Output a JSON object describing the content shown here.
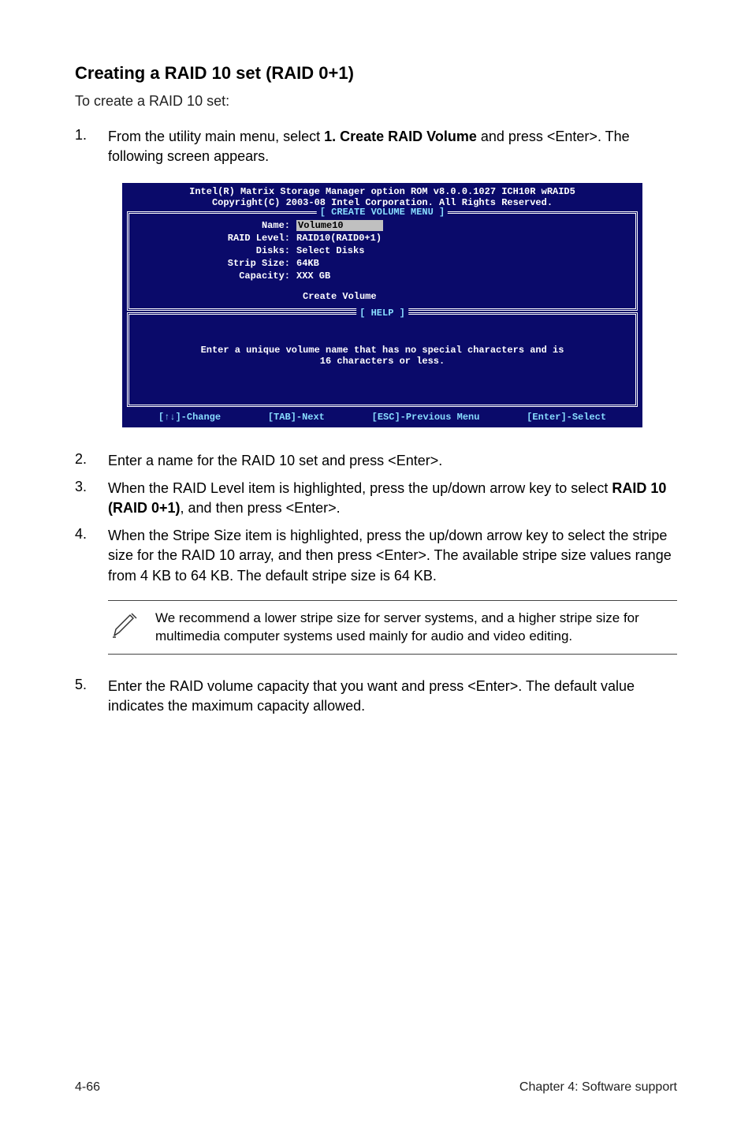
{
  "heading": "Creating a RAID 10 set (RAID 0+1)",
  "intro": "To create a RAID 10 set:",
  "steps": {
    "s1": {
      "num": "1.",
      "prefix": "From the utility main menu, select ",
      "bold": "1. Create RAID Volume",
      "suffix": " and press <Enter>. The following screen appears."
    },
    "s2": {
      "num": "2.",
      "text": "Enter a name for the RAID 10 set and press <Enter>."
    },
    "s3": {
      "num": "3.",
      "prefix": "When the RAID Level item is highlighted, press the up/down arrow key to select ",
      "bold": "RAID 10 (RAID 0+1)",
      "suffix": ", and then press <Enter>."
    },
    "s4": {
      "num": "4.",
      "text": "When the Stripe Size item is highlighted, press the up/down arrow key to select the stripe size for the RAID 10 array, and then press <Enter>. The available stripe size values range from 4 KB to 64 KB. The default stripe size is 64 KB."
    },
    "s5": {
      "num": "5.",
      "text": "Enter the RAID volume capacity that you want and press <Enter>. The default value indicates the maximum capacity allowed."
    }
  },
  "bios": {
    "title": "Intel(R) Matrix Storage Manager option ROM v8.0.0.1027 ICH10R wRAID5",
    "copyright": "Copyright(C) 2003-08 Intel Corporation. All Rights Reserved.",
    "create_legend": "[ CREATE VOLUME MENU ]",
    "help_legend": "[ HELP ]",
    "fields": {
      "name_label": "Name:",
      "name_value": "Volume10",
      "raid_label": "RAID Level:",
      "raid_value": "RAID10(RAID0+1)",
      "disks_label": "Disks:",
      "disks_value": "Select Disks",
      "strip_label": "Strip Size:",
      "strip_value": "64KB",
      "capacity_label": "Capacity:",
      "capacity_value": "XXX   GB"
    },
    "create_volume": "Create Volume",
    "help_text1": "Enter a unique volume name that has no special characters and is",
    "help_text2": "16 characters or less.",
    "footer": {
      "change": "[↑↓]-Change",
      "next": "[TAB]-Next",
      "prev": "[ESC]-Previous Menu",
      "select": "[Enter]-Select"
    }
  },
  "note": "We recommend a lower stripe size for server systems, and a higher stripe size for multimedia computer systems used mainly for audio and video editing.",
  "footer": {
    "left": "4-66",
    "right": "Chapter 4: Software support"
  }
}
